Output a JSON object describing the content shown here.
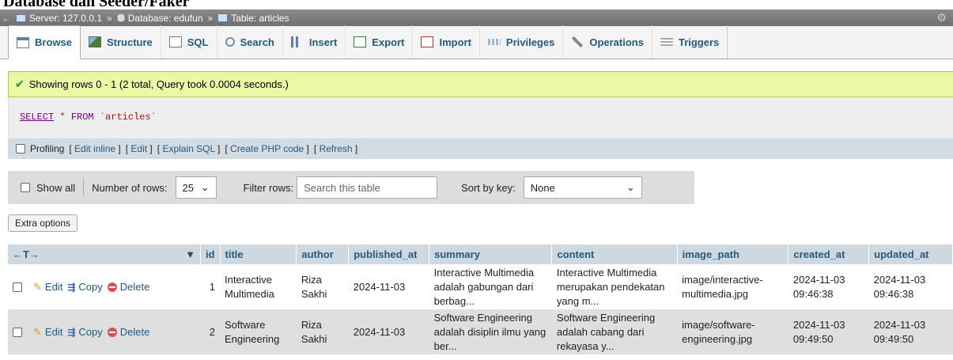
{
  "page_heading": "Database dan Seeder/Faker",
  "breadcrumb": {
    "server": "Server: 127.0.0.1",
    "database": "Database: edufun",
    "table": "Table: articles",
    "sep": "»"
  },
  "tabs": [
    {
      "label": "Browse",
      "icon": "browse-icon"
    },
    {
      "label": "Structure",
      "icon": "structure-icon"
    },
    {
      "label": "SQL",
      "icon": "sql-icon"
    },
    {
      "label": "Search",
      "icon": "search-icon"
    },
    {
      "label": "Insert",
      "icon": "insert-icon"
    },
    {
      "label": "Export",
      "icon": "export-icon"
    },
    {
      "label": "Import",
      "icon": "import-icon"
    },
    {
      "label": "Privileges",
      "icon": "privileges-icon"
    },
    {
      "label": "Operations",
      "icon": "operations-icon"
    },
    {
      "label": "Triggers",
      "icon": "triggers-icon"
    }
  ],
  "message": "Showing rows 0 - 1 (2 total, Query took 0.0004 seconds.)",
  "sql": {
    "select": "SELECT",
    "star": "*",
    "from": "FROM",
    "table": "`articles`"
  },
  "profiling": {
    "label": "Profiling",
    "links": [
      "Edit inline",
      "Edit",
      "Explain SQL",
      "Create PHP code",
      "Refresh"
    ]
  },
  "nav": {
    "show_all": "Show all",
    "number_of_rows_label": "Number of rows:",
    "number_of_rows_value": "25",
    "filter_label": "Filter rows:",
    "filter_placeholder": "Search this table",
    "sort_label": "Sort by key:",
    "sort_value": "None"
  },
  "extra_options": "Extra options",
  "columns": {
    "arrows": "←T→",
    "id": "id",
    "title": "title",
    "author": "author",
    "published_at": "published_at",
    "summary": "summary",
    "content": "content",
    "image_path": "image_path",
    "created_at": "created_at",
    "updated_at": "updated_at"
  },
  "row_actions": {
    "edit": "Edit",
    "copy": "Copy",
    "delete": "Delete"
  },
  "rows": [
    {
      "id": "1",
      "title": "Interactive Multimedia",
      "author": "Riza Sakhi",
      "published_at": "2024-11-03",
      "summary": "Interactive Multimedia adalah gabungan dari berbag...",
      "content": "Interactive Multimedia merupakan pendekatan yang m...",
      "image_path": "image/interactive-multimedia.jpg",
      "created_at": "2024-11-03 09:46:38",
      "updated_at": "2024-11-03 09:46:38"
    },
    {
      "id": "2",
      "title": "Software Engineering",
      "author": "Riza Sakhi",
      "published_at": "2024-11-03",
      "summary": "Software Engineering adalah disiplin ilmu yang ber...",
      "content": "Software Engineering adalah cabang dari rekayasa y...",
      "image_path": "image/software-engineering.jpg",
      "created_at": "2024-11-03 09:49:50",
      "updated_at": "2024-11-03 09:49:50"
    }
  ]
}
